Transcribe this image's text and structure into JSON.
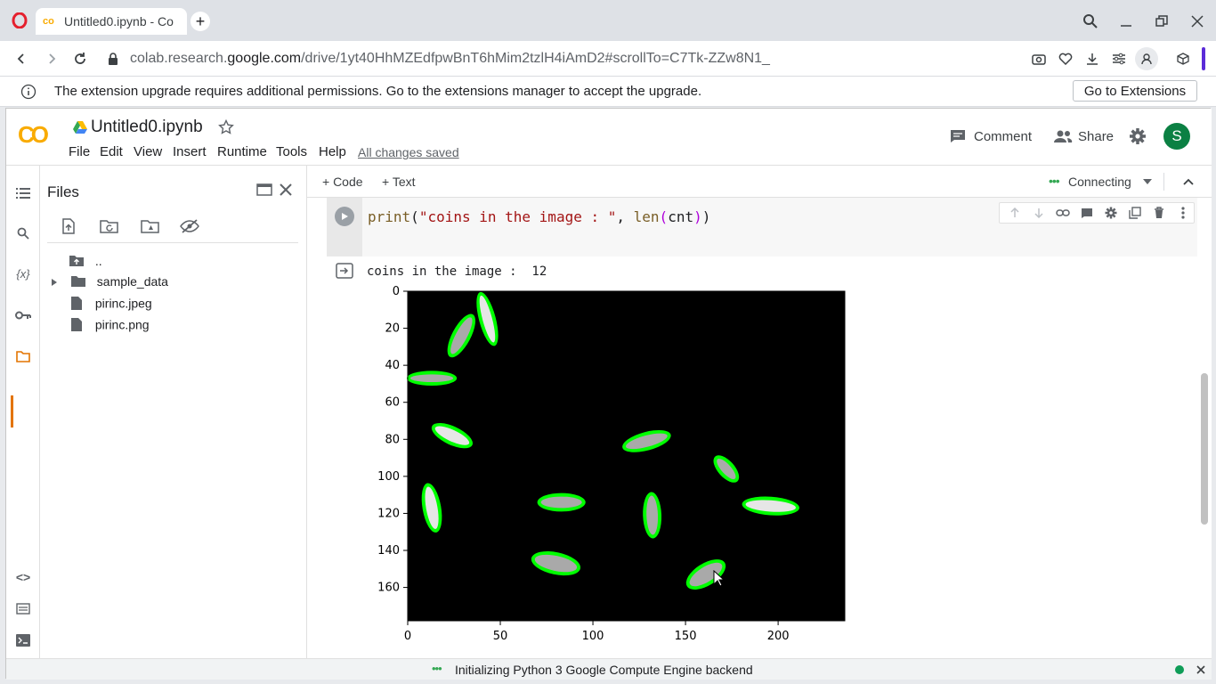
{
  "browser": {
    "tab_title": "Untitled0.ipynb - Co",
    "url_prefix": "colab.research.",
    "url_domain": "google.com",
    "url_path": "/drive/1yt40HhMZEdfpwBnT6hMim2tzlH4iAmD2#scrollTo=C7Tk-ZZw8N1_"
  },
  "infobar": {
    "message": "The extension upgrade requires additional permissions. Go to the extensions manager to accept the upgrade.",
    "button_label": "Go to Extensions"
  },
  "colab": {
    "logo_text": "CO",
    "notebook_title": "Untitled0.ipynb",
    "menu": [
      "File",
      "Edit",
      "View",
      "Insert",
      "Runtime",
      "Tools",
      "Help"
    ],
    "save_status": "All changes saved",
    "comment_label": "Comment",
    "share_label": "Share",
    "avatar_letter": "S",
    "add_code_label": "+ Code",
    "add_text_label": "+ Text",
    "runtime_status": "Connecting"
  },
  "files": {
    "title": "Files",
    "items": [
      {
        "name": "..",
        "type": "parent"
      },
      {
        "name": "sample_data",
        "type": "folder"
      },
      {
        "name": "pirinc.jpeg",
        "type": "file"
      },
      {
        "name": "pirinc.png",
        "type": "file"
      }
    ]
  },
  "cell": {
    "code_fn": "print",
    "code_str": "\"coins in the image : \"",
    "code_sep": ", ",
    "code_call": "len",
    "code_arg": "cnt",
    "output_text": "coins in the image :  12"
  },
  "plot": {
    "x_ticks": [
      "0",
      "50",
      "100",
      "150",
      "200"
    ],
    "y_ticks": [
      "0",
      "20",
      "40",
      "60",
      "80",
      "100",
      "120",
      "140",
      "160"
    ]
  },
  "status": {
    "message": "Initializing Python 3 Google Compute Engine backend"
  },
  "chart_data": {
    "type": "image",
    "image_width": 236,
    "image_height": 178,
    "xlim": [
      0,
      236
    ],
    "ylim": [
      178,
      0
    ],
    "objects": [
      {
        "cx": 43,
        "cy": 15,
        "length": 30,
        "width": 9,
        "angle": 75
      },
      {
        "cx": 29,
        "cy": 24,
        "length": 26,
        "width": 10,
        "angle": 118
      },
      {
        "cx": 13,
        "cy": 47,
        "length": 27,
        "width": 8,
        "angle": 0
      },
      {
        "cx": 24,
        "cy": 78,
        "length": 24,
        "width": 10,
        "angle": 25
      },
      {
        "cx": 129,
        "cy": 81,
        "length": 27,
        "width": 10,
        "angle": -15
      },
      {
        "cx": 172,
        "cy": 96,
        "length": 18,
        "width": 9,
        "angle": 48
      },
      {
        "cx": 13,
        "cy": 117,
        "length": 27,
        "width": 10,
        "angle": 80
      },
      {
        "cx": 83,
        "cy": 114,
        "length": 26,
        "width": 10,
        "angle": 0
      },
      {
        "cx": 132,
        "cy": 121,
        "length": 25,
        "width": 10,
        "angle": 88
      },
      {
        "cx": 196,
        "cy": 116,
        "length": 31,
        "width": 10,
        "angle": 4
      },
      {
        "cx": 80,
        "cy": 147,
        "length": 27,
        "width": 12,
        "angle": 12
      },
      {
        "cx": 161,
        "cy": 153,
        "length": 24,
        "width": 12,
        "angle": -32
      }
    ]
  }
}
